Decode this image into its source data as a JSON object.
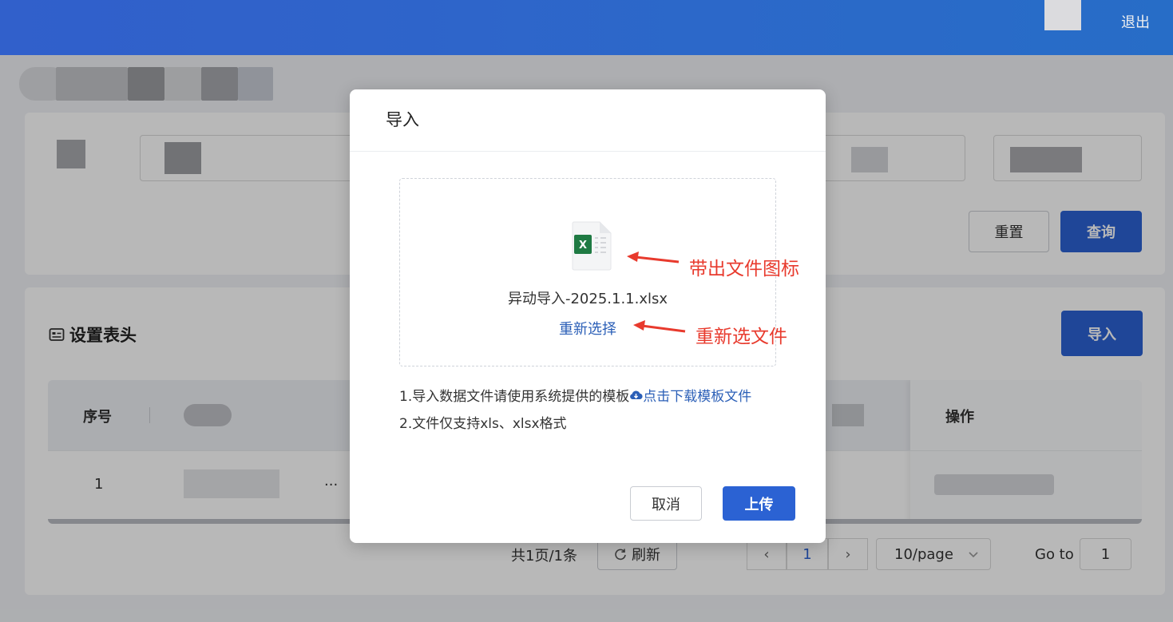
{
  "header": {
    "logout_label": "退出"
  },
  "page": {
    "search": {
      "reset_label": "重置",
      "query_label": "查询"
    },
    "table_section": {
      "title": "设置表头",
      "import_label": "导入"
    },
    "table": {
      "headers": [
        "序号",
        "操作"
      ],
      "row": {
        "index": "1",
        "ellipsis": "..."
      }
    },
    "pagination": {
      "total_text": "共1页/1条",
      "refresh_label": "刷新",
      "prev_icon": "‹",
      "current_page": "1",
      "next_icon": "›",
      "page_size": "10/page",
      "goto_label": "Go to",
      "goto_value": "1"
    }
  },
  "modal": {
    "title": "导入",
    "file_name": "异动导入-2025.1.1.xlsx",
    "reselect_label": "重新选择",
    "hint_1_prefix": "1.导入数据文件请使用系统提供的模板",
    "hint_1_link": "点击下载模板文件",
    "hint_2": "2.文件仅支持xls、xlsx格式",
    "cancel_label": "取消",
    "upload_label": "上传"
  },
  "annotations": {
    "file_icon_note": "带出文件图标",
    "reselect_note": "重新选文件"
  },
  "colors": {
    "primary": "#2b62d3",
    "link": "#2b5fb7",
    "annotation": "#e83a2d",
    "excel_green": "#1f7a43"
  },
  "icons": {
    "file": "excel-file-icon",
    "download": "cloud-download-icon",
    "refresh": "refresh-icon",
    "section": "table-header-icon"
  }
}
